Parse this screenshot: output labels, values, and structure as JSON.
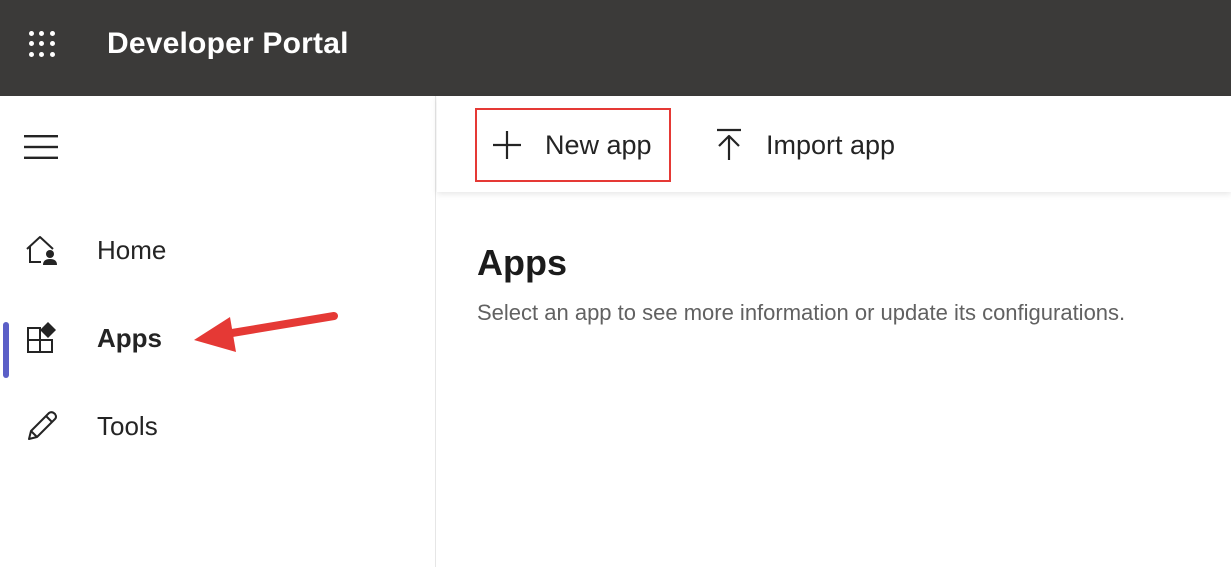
{
  "header": {
    "app_title": "Developer Portal",
    "launcher_icon": "waffle-icon",
    "background": "#3b3a39"
  },
  "sidebar": {
    "menu_icon": "hamburger-icon",
    "items": [
      {
        "label": "Home",
        "icon": "home-person-icon",
        "active": false
      },
      {
        "label": "Apps",
        "icon": "apps-icon",
        "active": true
      },
      {
        "label": "Tools",
        "icon": "pencil-icon",
        "active": false
      }
    ],
    "active_color": "#5b5fc7"
  },
  "toolbar": {
    "new_app": {
      "label": "New app",
      "icon": "plus-icon",
      "highlight_color": "#e53935"
    },
    "import_app": {
      "label": "Import app",
      "icon": "upload-icon"
    }
  },
  "main": {
    "title": "Apps",
    "subtitle": "Select an app to see more information or update its configurations."
  },
  "annotation": {
    "arrow_color": "#e53935",
    "points_to": "Apps"
  }
}
